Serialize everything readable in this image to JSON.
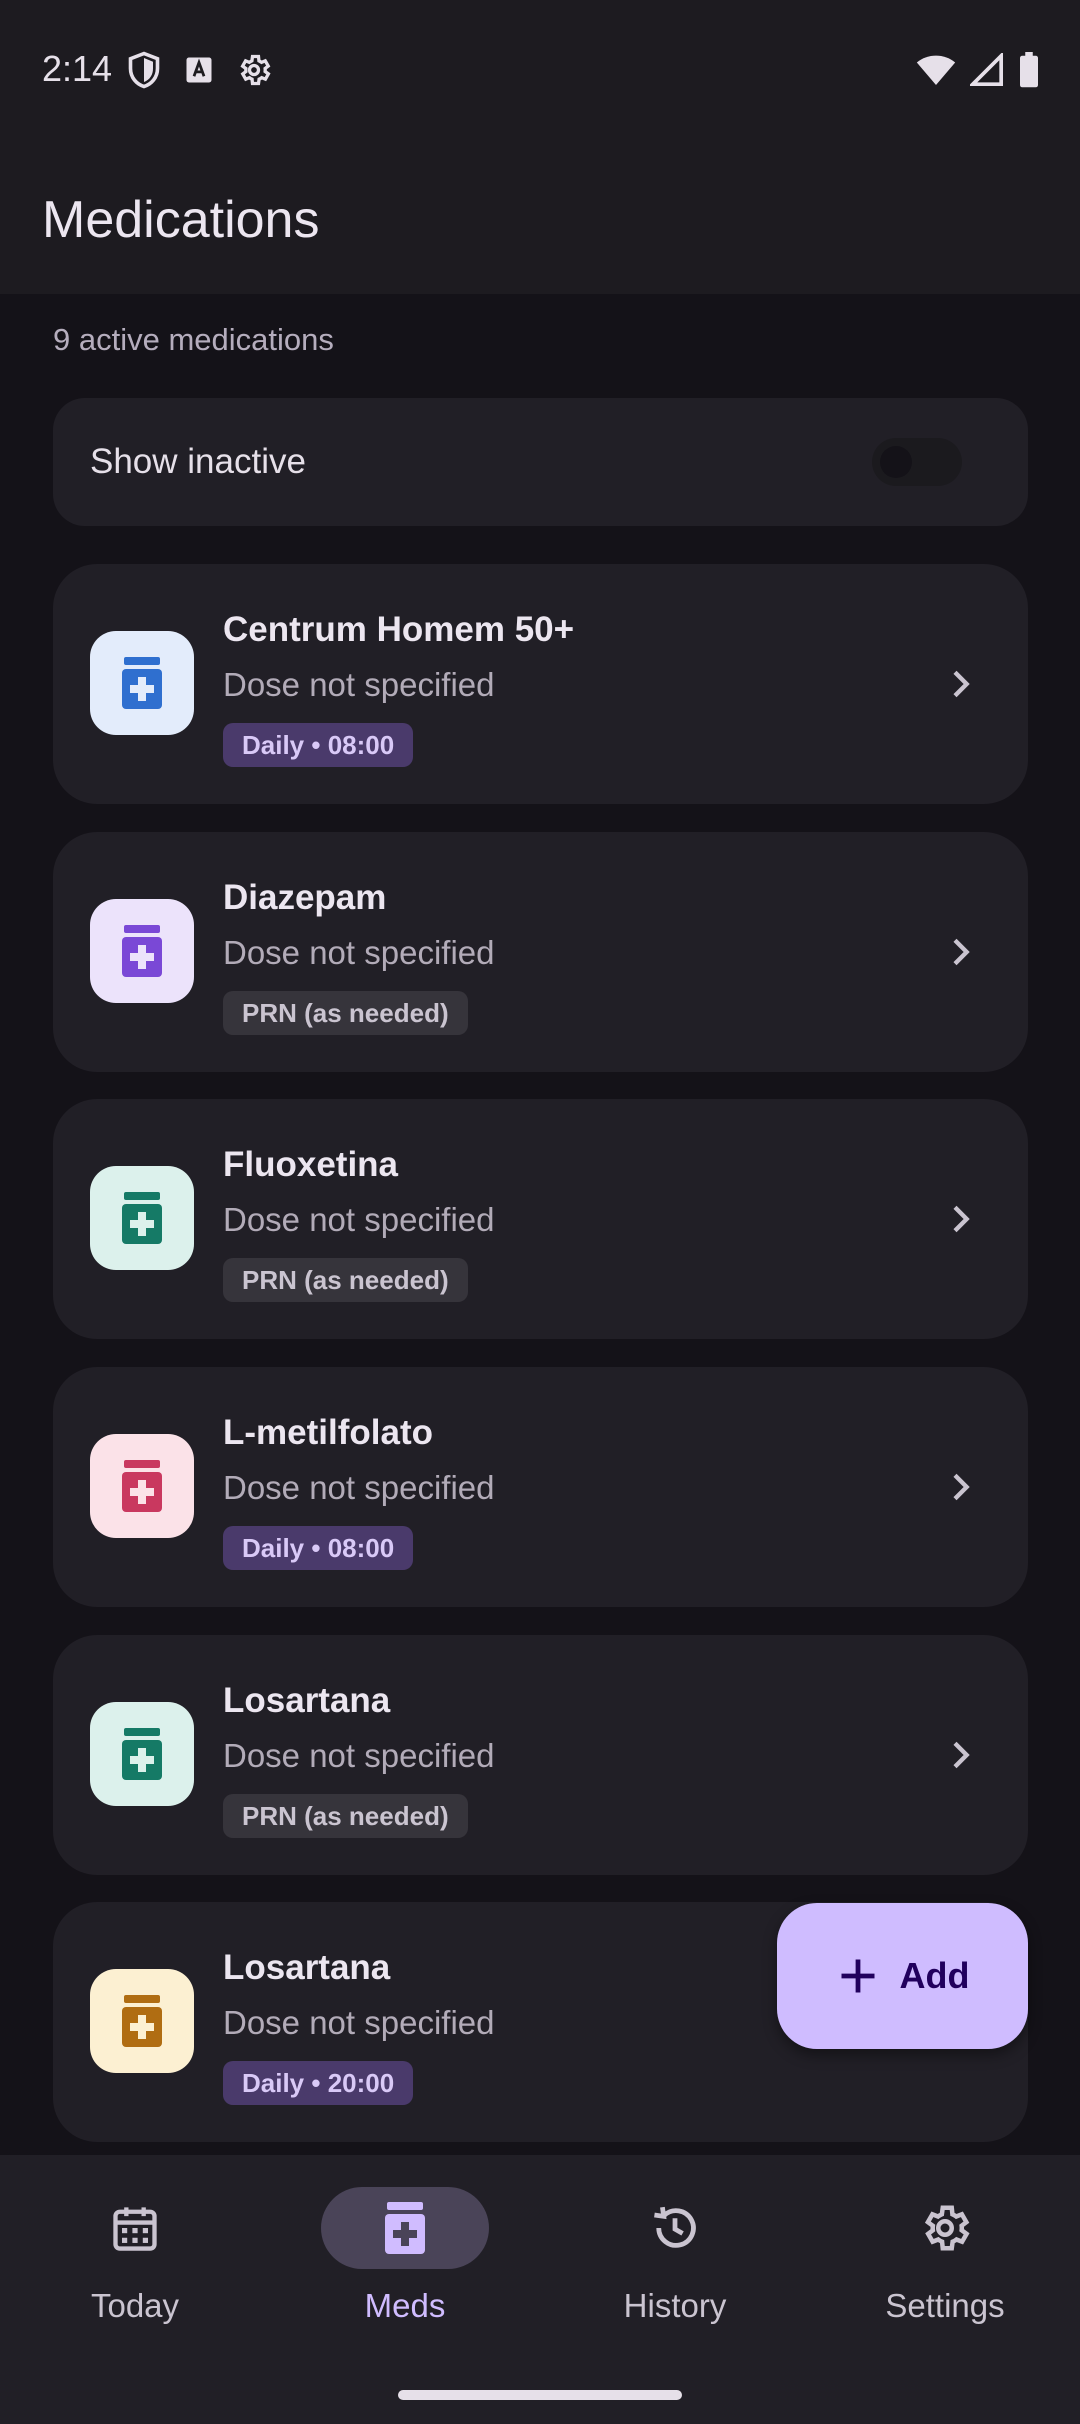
{
  "status_bar": {
    "time": "2:14",
    "left_icons": [
      "shield-icon",
      "keyboard-a-icon",
      "settings-gear-icon"
    ],
    "right_icons": [
      "wifi-icon",
      "signal-icon",
      "battery-icon"
    ]
  },
  "header": {
    "title": "Medications"
  },
  "summary": {
    "active_count_text": "9 active medications"
  },
  "show_inactive": {
    "label": "Show inactive",
    "enabled": false
  },
  "medications": [
    {
      "name": "Centrum Homem 50+",
      "dose": "Dose not specified",
      "schedule": "Daily • 08:00",
      "schedule_type": "daily",
      "icon": "medicine-bottle-icon",
      "icon_bg": "#e3ecfb",
      "icon_color": "#2f6fcf"
    },
    {
      "name": "Diazepam",
      "dose": "Dose not specified",
      "schedule": "PRN (as needed)",
      "schedule_type": "prn",
      "icon": "medicine-bottle-icon",
      "icon_bg": "#ece3fb",
      "icon_color": "#7a48d6"
    },
    {
      "name": "Fluoxetina",
      "dose": "Dose not specified",
      "schedule": "PRN (as needed)",
      "schedule_type": "prn",
      "icon": "medicine-bottle-icon",
      "icon_bg": "#dcf1ec",
      "icon_color": "#157a66"
    },
    {
      "name": "L-metilfolato",
      "dose": "Dose not specified",
      "schedule": "Daily • 08:00",
      "schedule_type": "daily",
      "icon": "medicine-bottle-icon",
      "icon_bg": "#fbe2e8",
      "icon_color": "#c9385f"
    },
    {
      "name": "Losartana",
      "dose": "Dose not specified",
      "schedule": "PRN (as needed)",
      "schedule_type": "prn",
      "icon": "medicine-bottle-icon",
      "icon_bg": "#dcf1ec",
      "icon_color": "#157a66"
    },
    {
      "name": "Losartana",
      "dose": "Dose not specified",
      "schedule": "Daily • 20:00",
      "schedule_type": "daily",
      "icon": "medicine-bottle-icon",
      "icon_bg": "#fcf0d2",
      "icon_color": "#b06d12"
    }
  ],
  "fab": {
    "label": "Add",
    "icon": "plus-icon"
  },
  "bottom_nav": [
    {
      "label": "Today",
      "icon": "calendar-icon",
      "active": false
    },
    {
      "label": "Meds",
      "icon": "medicine-bottle-icon",
      "active": true
    },
    {
      "label": "History",
      "icon": "history-icon",
      "active": false
    },
    {
      "label": "Settings",
      "icon": "gear-icon",
      "active": false
    }
  ],
  "colors": {
    "accent": "#d0bcff",
    "fab_bg": "#cfbcff",
    "surface": "#211f26",
    "background": "#141218"
  }
}
